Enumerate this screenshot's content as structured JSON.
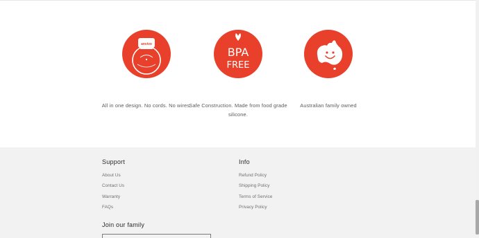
{
  "features": [
    {
      "caption": "All in one design. No cords. No wires.",
      "icon": "bottle-icon",
      "badge_text": "anvivo"
    },
    {
      "caption": "Safe Construction. Made from food grade silicone.",
      "icon": "bpa-free-icon",
      "badge_line1": "BPA",
      "badge_line2": "FREE"
    },
    {
      "caption": "Australian family owned",
      "icon": "australia-icon"
    }
  ],
  "footer": {
    "support": {
      "heading": "Support",
      "links": [
        "About Us",
        "Contact Us",
        "Warranty",
        "FAQs"
      ]
    },
    "info": {
      "heading": "Info",
      "links": [
        "Refund Policy",
        "Shipping Policy",
        "Terms of Service",
        "Privacy Policy"
      ]
    },
    "newsletter_heading": "Join our family"
  },
  "colors": {
    "accent": "#e8402a",
    "footer_bg": "#f2f2f2"
  }
}
